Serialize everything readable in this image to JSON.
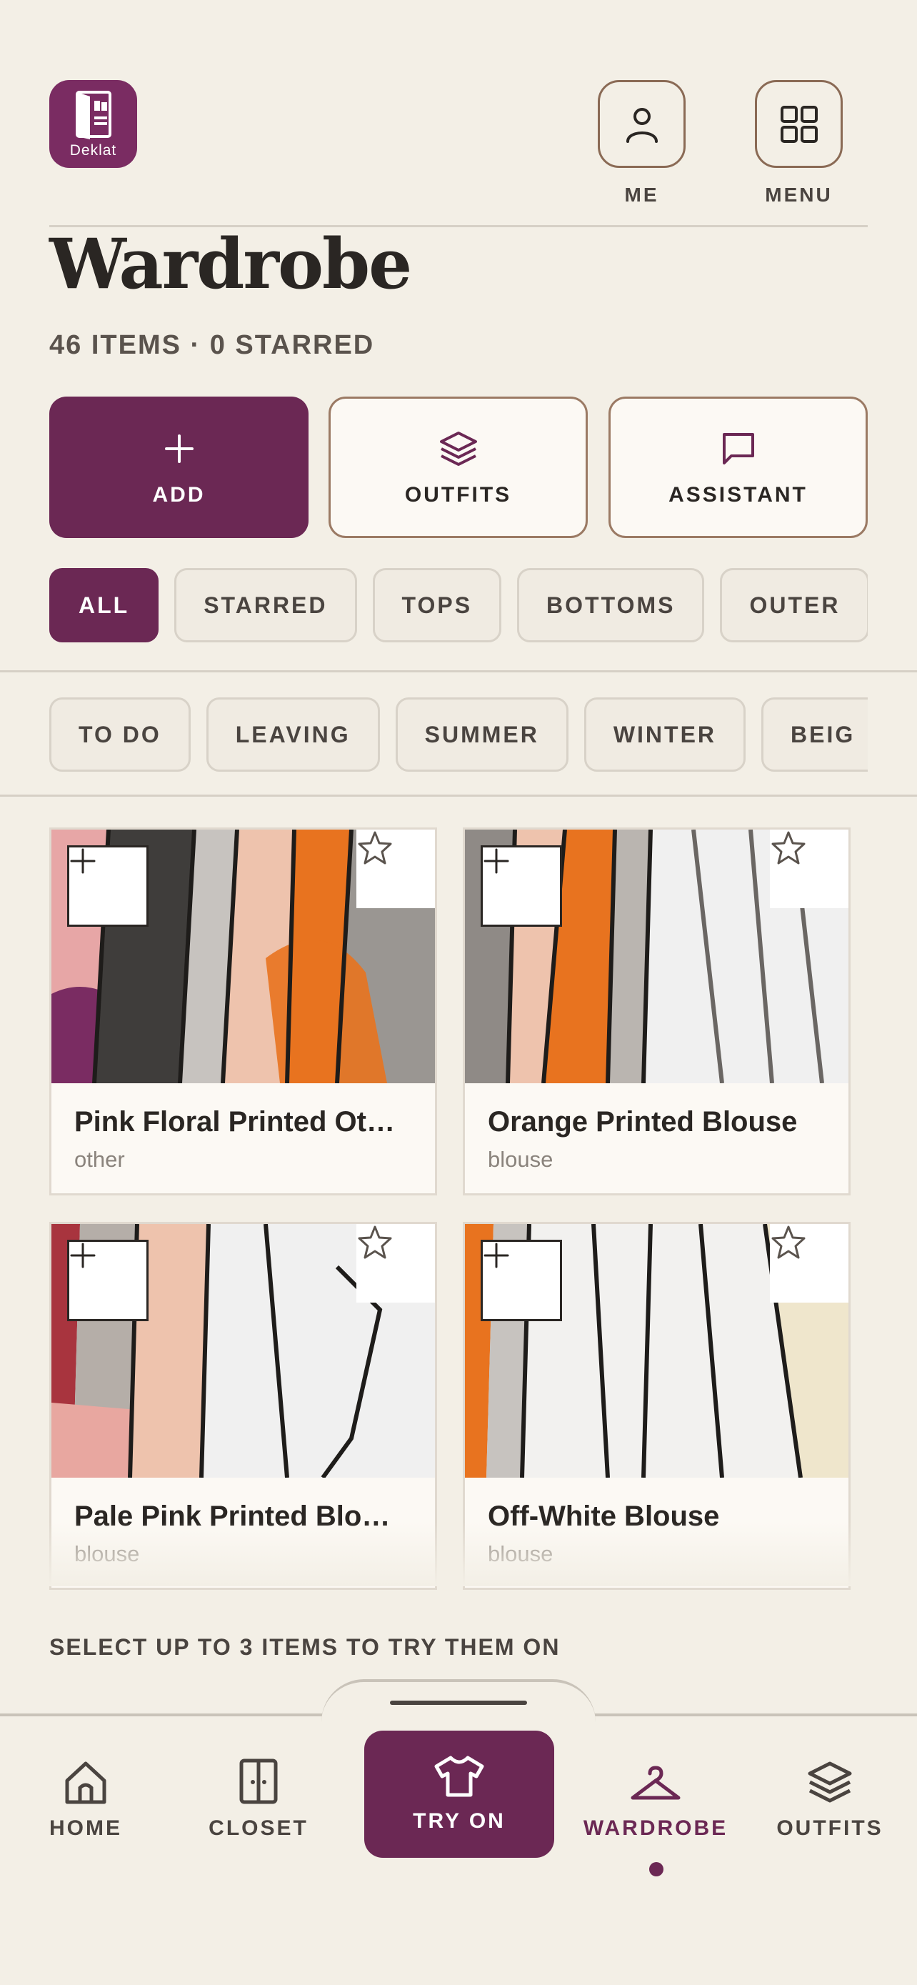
{
  "app": {
    "logo_text": "Deklat",
    "brand_color": "#6b2854"
  },
  "header": {
    "me_label": "ME",
    "menu_label": "MENU",
    "title": "Wardrobe",
    "subtitle": "46 ITEMS · 0 STARRED"
  },
  "actions": [
    {
      "label": "ADD",
      "icon": "plus-icon"
    },
    {
      "label": "OUTFITS",
      "icon": "layers-icon"
    },
    {
      "label": "ASSISTANT",
      "icon": "chat-bubble-icon"
    }
  ],
  "filters": [
    "ALL",
    "STARRED",
    "TOPS",
    "BOTTOMS",
    "OUTER"
  ],
  "active_filter": "ALL",
  "tags": [
    "TO DO",
    "LEAVING",
    "SUMMER",
    "WINTER",
    "BEIG"
  ],
  "items": [
    {
      "name": "Pink Floral Printed Ot…",
      "category": "other"
    },
    {
      "name": "Orange Printed Blouse",
      "category": "blouse"
    },
    {
      "name": "Pale Pink Printed Blo…",
      "category": "blouse"
    },
    {
      "name": "Off-White Blouse",
      "category": "blouse"
    }
  ],
  "hint": "SELECT UP TO 3 ITEMS TO TRY THEM ON",
  "nav": {
    "home": "HOME",
    "closet": "CLOSET",
    "try_on": "TRY ON",
    "wardrobe": "WARDROBE",
    "outfits": "OUTFITS",
    "active": "WARDROBE"
  }
}
